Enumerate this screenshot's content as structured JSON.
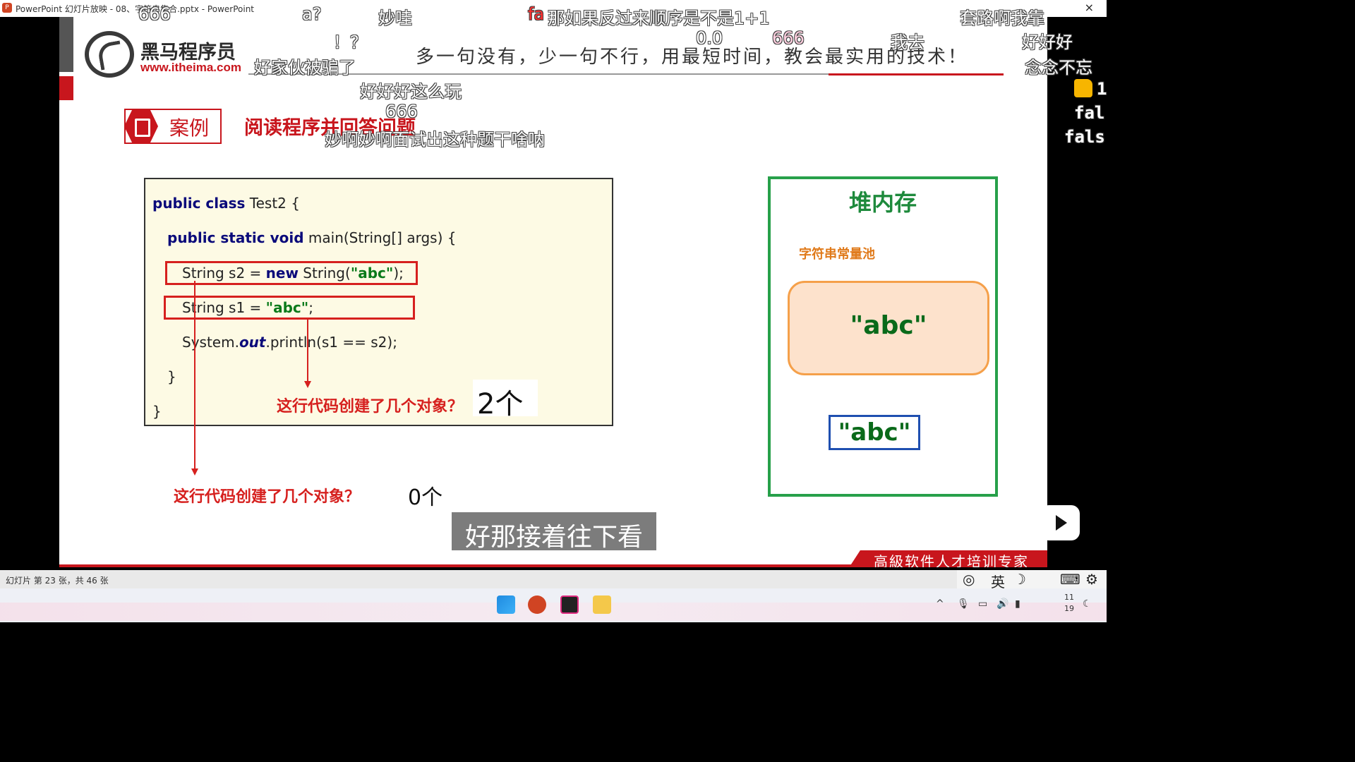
{
  "window": {
    "title": "PowerPoint 幻灯片放映 - 08、字符串集合.pptx - PowerPoint",
    "close_glyph": "×"
  },
  "slide": {
    "logo_cn": "黑马程序员",
    "logo_url": "www.itheima.com",
    "slogan": "多一句没有，少一句不行，用最短时间，教会最实用的技术！",
    "case_label": "案例",
    "case_title": "阅读程序并回答问题",
    "code": {
      "line1_kw": "public class",
      "line1_rest": " Test2 {",
      "line2_kw": "public static void",
      "line2_rest": " main(String[] args) {",
      "line3_a": "String s2 = ",
      "line3_kw": "new",
      "line3_b": " String(",
      "line3_str": "\"abc\"",
      "line3_c": ");",
      "line4_a": "String s1 = ",
      "line4_str": "\"abc\"",
      "line4_c": ";",
      "line5_a": "System.",
      "line5_it": "out",
      "line5_b": ".println(s1 == s2);",
      "line6": "}",
      "line7": "}"
    },
    "question_inner": "这行代码创建了几个对象？",
    "answer_inner": "2个",
    "question_outer": "这行代码创建了几个对象？",
    "answer_outer": "0个",
    "heap_title": "堆内存",
    "pool_label": "字符串常量池",
    "pool_value": "\"abc\"",
    "heap_object": "\"abc\"",
    "footer_tag": "高級软件人才培训专家"
  },
  "subtitle": "好那接着往下看",
  "danmaku": [
    "666",
    "a?",
    "妙哇",
    "fa",
    "那如果反过来顺序是不是1+1",
    "套路啊我靠",
    "！？",
    "0.0",
    "666",
    "我去",
    "好好好",
    "好家伙被骗了",
    "念念不忘",
    "好好好这么玩",
    "666",
    "妙啊妙啊面试出这种题干啥呐"
  ],
  "side": {
    "like_count": "1",
    "text1": "fal",
    "text2": "fals"
  },
  "statusbar": {
    "slide_count": "幻灯片 第 23 张，共 46 张",
    "ime_lang": "英"
  },
  "taskbar": {
    "time_top": "11",
    "time_bottom": "19"
  },
  "colors": {
    "brand_red": "#c8161d",
    "heap_green": "#27a04a",
    "pool_orange": "#f5a04a",
    "code_bg": "#fdfae4"
  }
}
